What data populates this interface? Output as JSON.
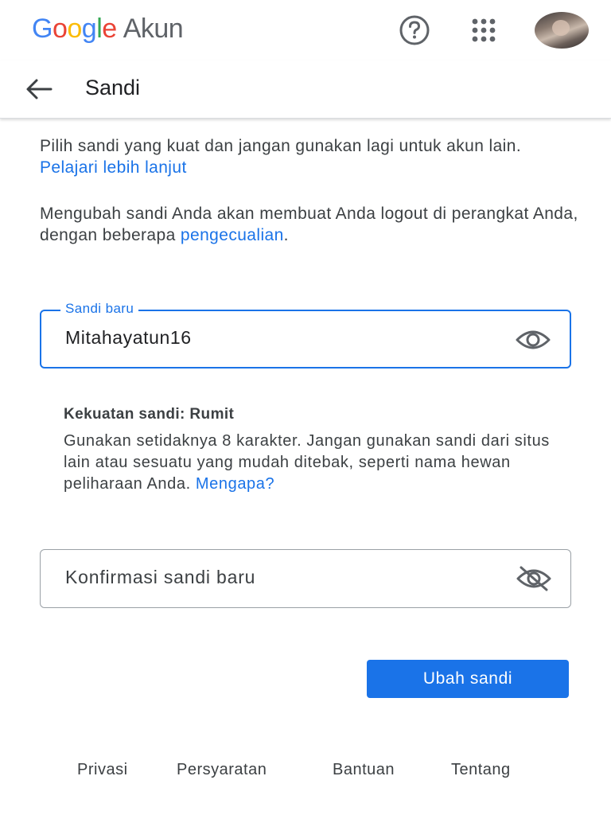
{
  "header": {
    "logo_letters": [
      {
        "char": "G",
        "color": "#4285f4"
      },
      {
        "char": "o",
        "color": "#ea4335"
      },
      {
        "char": "o",
        "color": "#fbbc05"
      },
      {
        "char": "g",
        "color": "#4285f4"
      },
      {
        "char": "l",
        "color": "#34a853"
      },
      {
        "char": "e",
        "color": "#ea4335"
      }
    ],
    "product": "Akun",
    "icons": [
      "help-icon",
      "apps-grid-icon",
      "avatar"
    ]
  },
  "page": {
    "back_icon": "arrow-back-icon",
    "title": "Sandi"
  },
  "intro": {
    "text": "Pilih sandi yang kuat dan jangan gunakan lagi untuk akun lain.",
    "link": "Pelajari lebih lanjut"
  },
  "notice": {
    "text": "Mengubah sandi Anda akan membuat Anda logout di perangkat Anda, dengan beberapa",
    "link": "pengecualian",
    "suffix": "."
  },
  "new_password": {
    "label": "Sandi baru",
    "value": "Mitahayatun16",
    "icon": "eye-icon"
  },
  "strength": {
    "title": "Kekuatan sandi: Rumit",
    "text": "Gunakan setidaknya 8 karakter. Jangan gunakan sandi dari situs lain atau sesuatu yang mudah ditebak, seperti nama hewan peliharaan Anda.",
    "link": "Mengapa?"
  },
  "confirm_password": {
    "placeholder": "Konfirmasi sandi baru",
    "icon": "eye-off-icon"
  },
  "submit_label": "Ubah sandi",
  "footer": {
    "links": [
      "Privasi",
      "Persyaratan",
      "Bantuan",
      "Tentang"
    ]
  },
  "colors": {
    "accent": "#1a73e8",
    "text": "#3c4043",
    "google_blue": "#4285f4",
    "google_red": "#ea4335",
    "google_yellow": "#fbbc05",
    "google_green": "#34a853"
  }
}
